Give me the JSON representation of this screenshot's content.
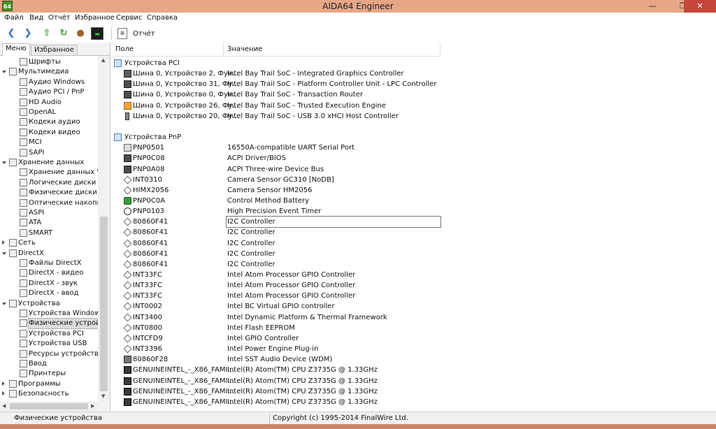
{
  "window": {
    "title": "AIDA64 Engineer",
    "app_icon_text": "64"
  },
  "menu": [
    "Файл",
    "Вид",
    "Отчёт",
    "Избранное",
    "Сервис",
    "Справка"
  ],
  "toolbar": {
    "report_label": "Отчёт"
  },
  "left_tabs": [
    "Меню",
    "Избранное"
  ],
  "tree": [
    {
      "label": "Шрифты",
      "level": 2,
      "expand": ""
    },
    {
      "label": "Мультимедиа",
      "level": 1,
      "expand": "open"
    },
    {
      "label": "Аудио Windows",
      "level": 2,
      "expand": ""
    },
    {
      "label": "Аудио PCI / PnP",
      "level": 2,
      "expand": ""
    },
    {
      "label": "HD Audio",
      "level": 2,
      "expand": ""
    },
    {
      "label": "OpenAL",
      "level": 2,
      "expand": ""
    },
    {
      "label": "Кодеки аудио",
      "level": 2,
      "expand": ""
    },
    {
      "label": "Кодеки видео",
      "level": 2,
      "expand": ""
    },
    {
      "label": "MCI",
      "level": 2,
      "expand": ""
    },
    {
      "label": "SAPI",
      "level": 2,
      "expand": ""
    },
    {
      "label": "Хранение данных",
      "level": 1,
      "expand": "open"
    },
    {
      "label": "Хранение данных W",
      "level": 2,
      "expand": ""
    },
    {
      "label": "Логические диски",
      "level": 2,
      "expand": ""
    },
    {
      "label": "Физические диски",
      "level": 2,
      "expand": ""
    },
    {
      "label": "Оптические накопи",
      "level": 2,
      "expand": ""
    },
    {
      "label": "ASPI",
      "level": 2,
      "expand": ""
    },
    {
      "label": "ATA",
      "level": 2,
      "expand": ""
    },
    {
      "label": "SMART",
      "level": 2,
      "expand": ""
    },
    {
      "label": "Сеть",
      "level": 1,
      "expand": "closed"
    },
    {
      "label": "DirectX",
      "level": 1,
      "expand": "open"
    },
    {
      "label": "Файлы DirectX",
      "level": 2,
      "expand": ""
    },
    {
      "label": "DirectX - видео",
      "level": 2,
      "expand": ""
    },
    {
      "label": "DirectX - звук",
      "level": 2,
      "expand": ""
    },
    {
      "label": "DirectX - ввод",
      "level": 2,
      "expand": ""
    },
    {
      "label": "Устройства",
      "level": 1,
      "expand": "open"
    },
    {
      "label": "Устройства Window",
      "level": 2,
      "expand": ""
    },
    {
      "label": "Физические устрой",
      "level": 2,
      "expand": "",
      "selected": true
    },
    {
      "label": "Устройства PCI",
      "level": 2,
      "expand": ""
    },
    {
      "label": "Устройства USB",
      "level": 2,
      "expand": ""
    },
    {
      "label": "Ресурсы устройств",
      "level": 2,
      "expand": ""
    },
    {
      "label": "Ввод",
      "level": 2,
      "expand": ""
    },
    {
      "label": "Принтеры",
      "level": 2,
      "expand": ""
    },
    {
      "label": "Программы",
      "level": 1,
      "expand": "closed"
    },
    {
      "label": "Безопасность",
      "level": 1,
      "expand": "closed"
    }
  ],
  "columns": {
    "field": "Поле",
    "value": "Значение"
  },
  "rows": [
    {
      "type": "group",
      "field": "Устройства PCI",
      "value": "",
      "icon": "grp"
    },
    {
      "type": "item",
      "field": "Шина 0, Устройство 2, Фун...",
      "value": "Intel Bay Trail SoC - Integrated Graphics Controller",
      "icon": "pci"
    },
    {
      "type": "item",
      "field": "Шина 0, Устройство 31, Фу...",
      "value": "Intel Bay Trail SoC - Platform Controller Unit - LPC Controller",
      "icon": "dev"
    },
    {
      "type": "item",
      "field": "Шина 0, Устройство 0, Фун...",
      "value": "Intel Bay Trail SoC - Transaction Router",
      "icon": "dev"
    },
    {
      "type": "item",
      "field": "Шина 0, Устройство 26, Фу...",
      "value": "Intel Bay Trail SoC - Trusted Execution Engine",
      "icon": "orange"
    },
    {
      "type": "item",
      "field": "Шина 0, Устройство 20, Фу...",
      "value": "Intel Bay Trail SoC - USB 3.0 xHCI Host Controller",
      "icon": "usb"
    },
    {
      "type": "blank",
      "field": "",
      "value": "",
      "icon": ""
    },
    {
      "type": "group",
      "field": "Устройства PnP",
      "value": "",
      "icon": "grp"
    },
    {
      "type": "item",
      "field": "PNP0501",
      "value": "16550A-compatible UART Serial Port",
      "icon": "port"
    },
    {
      "type": "item",
      "field": "PNP0C08",
      "value": "ACPI Driver/BIOS",
      "icon": "dev"
    },
    {
      "type": "item",
      "field": "PNP0A08",
      "value": "ACPI Three-wire Device Bus",
      "icon": "dev"
    },
    {
      "type": "item",
      "field": "INT0310",
      "value": "Camera Sensor GC310 [NoDB]",
      "icon": "chip"
    },
    {
      "type": "item",
      "field": "HIMX2056",
      "value": "Camera Sensor HM2056",
      "icon": "chip"
    },
    {
      "type": "item",
      "field": "PNP0C0A",
      "value": "Control Method Battery",
      "icon": "batt"
    },
    {
      "type": "item",
      "field": "PNP0103",
      "value": "High Precision Event Timer",
      "icon": "clock"
    },
    {
      "type": "item",
      "field": "80860F41",
      "value": "I2C Controller",
      "icon": "chip",
      "focus": true
    },
    {
      "type": "item",
      "field": "80860F41",
      "value": "I2C Controller",
      "icon": "chip"
    },
    {
      "type": "item",
      "field": "80860F41",
      "value": "I2C Controller",
      "icon": "chip"
    },
    {
      "type": "item",
      "field": "80860F41",
      "value": "I2C Controller",
      "icon": "chip"
    },
    {
      "type": "item",
      "field": "80860F41",
      "value": "I2C Controller",
      "icon": "chip"
    },
    {
      "type": "item",
      "field": "INT33FC",
      "value": "Intel Atom Processor GPIO Controller",
      "icon": "chip"
    },
    {
      "type": "item",
      "field": "INT33FC",
      "value": "Intel Atom Processor GPIO Controller",
      "icon": "chip"
    },
    {
      "type": "item",
      "field": "INT33FC",
      "value": "Intel Atom Processor GPIO Controller",
      "icon": "chip"
    },
    {
      "type": "item",
      "field": "INT0002",
      "value": "Intel BC Virtual GPIO controller",
      "icon": "chip"
    },
    {
      "type": "item",
      "field": "INT3400",
      "value": "Intel Dynamic Platform & Thermal Framework",
      "icon": "chip"
    },
    {
      "type": "item",
      "field": "INT0800",
      "value": "Intel Flash EEPROM",
      "icon": "chip"
    },
    {
      "type": "item",
      "field": "INTCFD9",
      "value": "Intel GPIO Controller",
      "icon": "chip"
    },
    {
      "type": "item",
      "field": "INT3396",
      "value": "Intel Power Engine Plug-in",
      "icon": "chip"
    },
    {
      "type": "item",
      "field": "80860F28",
      "value": "Intel SST Audio Device (WDM)",
      "icon": "audio"
    },
    {
      "type": "item",
      "field": "GENUINEINTEL_-_X86_FAMI...",
      "value": "Intel(R) Atom(TM) CPU  Z3735G @ 1.33GHz",
      "icon": "cpu"
    },
    {
      "type": "item",
      "field": "GENUINEINTEL_-_X86_FAMI...",
      "value": "Intel(R) Atom(TM) CPU  Z3735G @ 1.33GHz",
      "icon": "cpu"
    },
    {
      "type": "item",
      "field": "GENUINEINTEL_-_X86_FAMI...",
      "value": "Intel(R) Atom(TM) CPU  Z3735G @ 1.33GHz",
      "icon": "cpu"
    },
    {
      "type": "item",
      "field": "GENUINEINTEL_-_X86_FAMI...",
      "value": "Intel(R) Atom(TM) CPU  Z3735G @ 1.33GHz",
      "icon": "cpu"
    }
  ],
  "status": {
    "left": "Физические устройства",
    "right": "Copyright (c) 1995-2014 FinalWire Ltd."
  }
}
